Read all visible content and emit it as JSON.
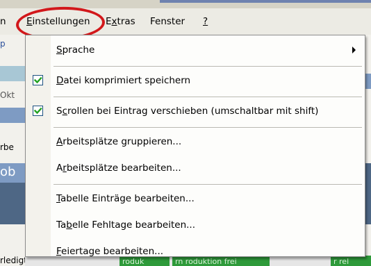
{
  "menubar": {
    "partial_left": "n",
    "items": [
      {
        "label": "Einstellungen",
        "accel_index": 0
      },
      {
        "label": "Extras",
        "accel_index": 1
      },
      {
        "label": "Fenster",
        "accel_index": -1
      },
      {
        "label": "?",
        "accel_index": 0
      }
    ]
  },
  "background": {
    "left_fragments": [
      "Okt",
      "rbe",
      "ob",
      "rledigt"
    ],
    "bottom_fragments": [
      "roduk",
      "rn roduktion frei",
      "r rel"
    ]
  },
  "menu": {
    "items": [
      {
        "type": "item",
        "label": "Sprache",
        "accel_index": 0,
        "submenu": true,
        "checked": false
      },
      {
        "type": "separator"
      },
      {
        "type": "item",
        "label": "Datei komprimiert speichern",
        "accel_index": 0,
        "checked": true
      },
      {
        "type": "separator"
      },
      {
        "type": "item",
        "label": "Scrollen bei Eintrag verschieben (umschaltbar mit shift)",
        "accel_index": 1,
        "checked": true
      },
      {
        "type": "separator"
      },
      {
        "type": "item",
        "label": "Arbeitsplätze gruppieren...",
        "accel_index": 0,
        "checked": false
      },
      {
        "type": "item",
        "label": "Arbeitsplätze bearbeiten...",
        "accel_index": 1,
        "checked": false
      },
      {
        "type": "separator"
      },
      {
        "type": "item",
        "label": "Tabelle Einträge bearbeiten...",
        "accel_index": 0,
        "checked": false
      },
      {
        "type": "item",
        "label": "Tabelle Fehltage bearbeiten...",
        "accel_index": 2,
        "checked": false
      },
      {
        "type": "item",
        "label": "Feiertage bearbeiten...",
        "accel_index": 0,
        "checked": false
      }
    ]
  },
  "colors": {
    "highlight_ring": "#d2181b",
    "check_border": "#1c5180",
    "check_mark": "#21a121"
  },
  "icons": {
    "checkmark": "checkbox-checked-icon",
    "submenu": "submenu-arrow-icon"
  }
}
